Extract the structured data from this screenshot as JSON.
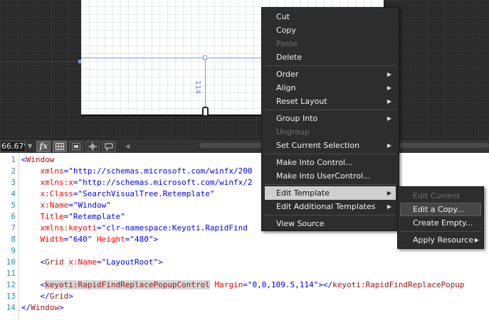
{
  "design_surface": {
    "guide_measure": "114"
  },
  "statusbar": {
    "zoom": "66.67%",
    "fx_label": "fx"
  },
  "code_lines": [
    {
      "n": "1",
      "parts": [
        {
          "t": "<",
          "c": "punct"
        },
        {
          "t": "Window",
          "c": "tag"
        }
      ]
    },
    {
      "n": "2",
      "parts": [
        {
          "t": "    xmlns",
          "c": "attr"
        },
        {
          "t": "=",
          "c": "punct"
        },
        {
          "t": "\"http://schemas.microsoft.com/winfx/200",
          "c": "val"
        }
      ]
    },
    {
      "n": "3",
      "parts": [
        {
          "t": "    xmlns:x",
          "c": "attr"
        },
        {
          "t": "=",
          "c": "punct"
        },
        {
          "t": "\"http://schemas.microsoft.com/winfx/2",
          "c": "val"
        }
      ]
    },
    {
      "n": "4",
      "parts": [
        {
          "t": "    x:Class",
          "c": "attr"
        },
        {
          "t": "=",
          "c": "punct"
        },
        {
          "t": "\"SearchVisualTree.Retemplate\"",
          "c": "val"
        }
      ]
    },
    {
      "n": "5",
      "parts": [
        {
          "t": "    x:Name",
          "c": "attr"
        },
        {
          "t": "=",
          "c": "punct"
        },
        {
          "t": "\"Window\"",
          "c": "val"
        }
      ]
    },
    {
      "n": "6",
      "parts": [
        {
          "t": "    Title",
          "c": "attr"
        },
        {
          "t": "=",
          "c": "punct"
        },
        {
          "t": "\"Retemplate\"",
          "c": "val"
        }
      ]
    },
    {
      "n": "7",
      "parts": [
        {
          "t": "    xmlns:keyoti",
          "c": "attr"
        },
        {
          "t": "=",
          "c": "punct"
        },
        {
          "t": "\"clr-namespace:Keyoti.RapidFind",
          "c": "val"
        },
        {
          "t": "                        .",
          "c": "val"
        }
      ]
    },
    {
      "n": "8",
      "parts": [
        {
          "t": "    Width",
          "c": "attr"
        },
        {
          "t": "=",
          "c": "punct"
        },
        {
          "t": "\"640\"",
          "c": "val"
        },
        {
          "t": " Height",
          "c": "attr"
        },
        {
          "t": "=",
          "c": "punct"
        },
        {
          "t": "\"480\"",
          "c": "val"
        },
        {
          "t": ">",
          "c": "punct"
        }
      ]
    },
    {
      "n": "9",
      "parts": []
    },
    {
      "n": "10",
      "parts": [
        {
          "t": "    <",
          "c": "punct"
        },
        {
          "t": "Grid",
          "c": "tag"
        },
        {
          "t": " x:Name",
          "c": "attr"
        },
        {
          "t": "=",
          "c": "punct"
        },
        {
          "t": "\"LayoutRoot\"",
          "c": "val"
        },
        {
          "t": ">",
          "c": "punct"
        }
      ]
    },
    {
      "n": "11",
      "parts": []
    },
    {
      "n": "12",
      "parts": [
        {
          "t": "    <",
          "c": "punct"
        },
        {
          "t": "keyoti:RapidFindReplacePopupControl",
          "c": "tag hl"
        },
        {
          "t": " Margin",
          "c": "attr"
        },
        {
          "t": "=",
          "c": "punct"
        },
        {
          "t": "\"0,0,109.5,114\"",
          "c": "val"
        },
        {
          "t": "></",
          "c": "punct"
        },
        {
          "t": "keyoti:RapidFindReplacePopup",
          "c": "tag"
        }
      ]
    },
    {
      "n": "13",
      "parts": [
        {
          "t": "    </",
          "c": "punct"
        },
        {
          "t": "Grid",
          "c": "tag"
        },
        {
          "t": ">",
          "c": "punct"
        }
      ]
    },
    {
      "n": "14",
      "parts": [
        {
          "t": "</",
          "c": "punct"
        },
        {
          "t": "Window",
          "c": "tag"
        },
        {
          "t": ">",
          "c": "punct"
        }
      ]
    }
  ],
  "context_menu": {
    "items": [
      {
        "label": "Cut"
      },
      {
        "label": "Copy"
      },
      {
        "label": "Paste",
        "disabled": true
      },
      {
        "label": "Delete"
      },
      {
        "label": "Order",
        "submenu": true
      },
      {
        "label": "Align",
        "submenu": true
      },
      {
        "label": "Reset Layout",
        "submenu": true
      },
      {
        "label": "Group Into",
        "submenu": true
      },
      {
        "label": "Ungroup",
        "disabled": true
      },
      {
        "label": "Set Current Selection",
        "submenu": true
      },
      {
        "label": "Make Into Control..."
      },
      {
        "label": "Make Into UserControl..."
      },
      {
        "label": "Edit Template",
        "submenu": true,
        "selected": true
      },
      {
        "label": "Edit Additional Templates",
        "submenu": true
      },
      {
        "label": "View Source"
      }
    ]
  },
  "edit_template_submenu": {
    "items": [
      {
        "label": "Edit Current",
        "disabled": true
      },
      {
        "label": "Edit a Copy...",
        "hover": true
      },
      {
        "label": "Create Empty..."
      },
      {
        "label": "Apply Resource",
        "submenu": true
      }
    ]
  },
  "colors": {
    "menu_bg": "#2d2d2d",
    "selected_item_bg": "#cfcfcf",
    "xaml_tag": "#a31515",
    "xaml_attr": "#ff0000",
    "xaml_value": "#0000ff",
    "line_number": "#2b91af"
  }
}
